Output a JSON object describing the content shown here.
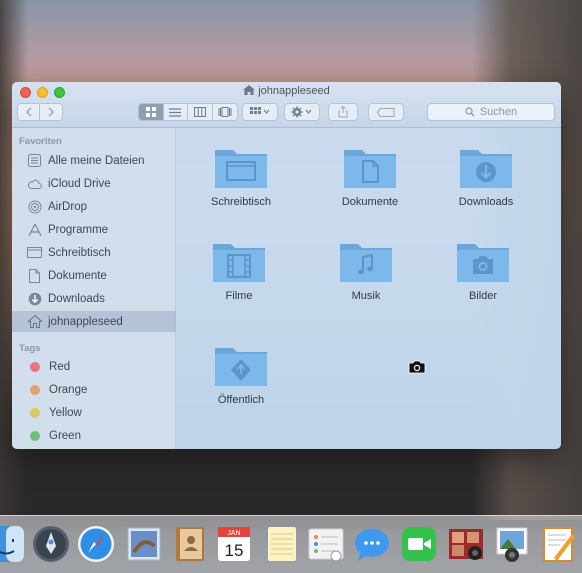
{
  "window": {
    "title": "johnappleseed",
    "search_placeholder": "Suchen"
  },
  "toolbar": {
    "back": "back",
    "forward": "forward",
    "views": [
      "icon-view",
      "list-view",
      "column-view",
      "coverflow-view"
    ],
    "active_view": "icon-view",
    "arrange": "arrange",
    "action": "action",
    "share": "share",
    "tags": "tags"
  },
  "sidebar": {
    "favorites_heading": "Favoriten",
    "favorites": [
      {
        "label": "Alle meine Dateien",
        "icon": "all-files-icon"
      },
      {
        "label": "iCloud Drive",
        "icon": "cloud-icon"
      },
      {
        "label": "AirDrop",
        "icon": "airdrop-icon"
      },
      {
        "label": "Programme",
        "icon": "applications-icon"
      },
      {
        "label": "Schreibtisch",
        "icon": "desktop-icon"
      },
      {
        "label": "Dokumente",
        "icon": "documents-icon"
      },
      {
        "label": "Downloads",
        "icon": "downloads-icon"
      },
      {
        "label": "johnappleseed",
        "icon": "home-icon",
        "selected": true
      }
    ],
    "tags_heading": "Tags",
    "tags": [
      {
        "label": "Red",
        "color": "#e8747c"
      },
      {
        "label": "Orange",
        "color": "#dfa36f"
      },
      {
        "label": "Yellow",
        "color": "#d9c86a"
      },
      {
        "label": "Green",
        "color": "#6fc07a"
      }
    ]
  },
  "folders": [
    {
      "label": "Schreibtisch",
      "icon": "desktop-folder-icon"
    },
    {
      "label": "Dokumente",
      "icon": "documents-folder-icon"
    },
    {
      "label": "Downloads",
      "icon": "downloads-folder-icon"
    },
    {
      "label": "Filme",
      "icon": "movies-folder-icon"
    },
    {
      "label": "Musik",
      "icon": "music-folder-icon"
    },
    {
      "label": "Bilder",
      "icon": "pictures-folder-icon"
    },
    {
      "label": "Öffentlich",
      "icon": "public-folder-icon"
    }
  ],
  "colors": {
    "folder": "#7db8ea",
    "folder_tab": "#6aa8dc",
    "folder_glyph": "#5a96c8"
  },
  "dock": {
    "apps": [
      "finder-icon",
      "launchpad-icon",
      "safari-icon",
      "mail-icon",
      "contacts-icon",
      "calendar-icon",
      "notes-icon",
      "reminders-icon",
      "messages-icon",
      "facetime-icon",
      "photo-booth-icon",
      "iphoto-icon",
      "pages-icon"
    ],
    "calendar_month": "JAN",
    "calendar_day": "15"
  }
}
